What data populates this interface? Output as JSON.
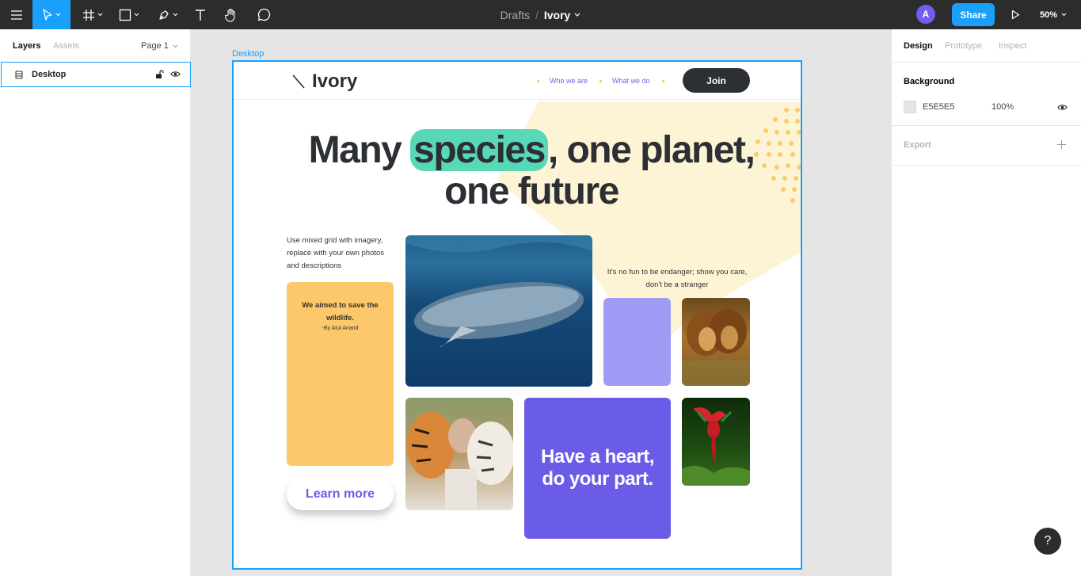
{
  "toolbar": {
    "breadcrumb_parent": "Drafts",
    "breadcrumb_sep": "/",
    "file_name": "Ivory",
    "avatar_initial": "A",
    "share_label": "Share",
    "zoom": "50%"
  },
  "left_panel": {
    "tab_layers": "Layers",
    "tab_assets": "Assets",
    "page_selector": "Page 1",
    "layers": [
      {
        "name": "Desktop"
      }
    ]
  },
  "canvas": {
    "frame_label": "Desktop",
    "artboard": {
      "logo": "Ivory",
      "nav_links": [
        "Who we are",
        "What we do"
      ],
      "join_label": "Join",
      "headline_pre": "Many ",
      "headline_highlight": "species",
      "headline_post": ", one planet,",
      "headline_line2": "one future",
      "intro_text": "Use mixed grid with imagery, replace with your own photos and descriptions",
      "quote_text": "We aimed to save the wildlife.",
      "quote_author": "-By Atul Anand",
      "learn_more": "Learn more",
      "side_text": "It's no fun to be endanger; show you care, don't be a stranger",
      "cta_text": "Have a heart, do your part."
    }
  },
  "right_panel": {
    "tab_design": "Design",
    "tab_prototype": "Prototype",
    "tab_inspect": "Inspect",
    "background_title": "Background",
    "background_hex": "E5E5E5",
    "background_opacity": "100%",
    "export_title": "Export"
  },
  "help_label": "?",
  "colors": {
    "accent": "#18a0fb",
    "toolbar_bg": "#2c2c2c",
    "highlight": "#58d8b6",
    "quote_card": "#fcc86b",
    "lavender": "#a29bf5",
    "purple": "#6b5ce7",
    "sun_yellow": "#fdf4d6"
  }
}
